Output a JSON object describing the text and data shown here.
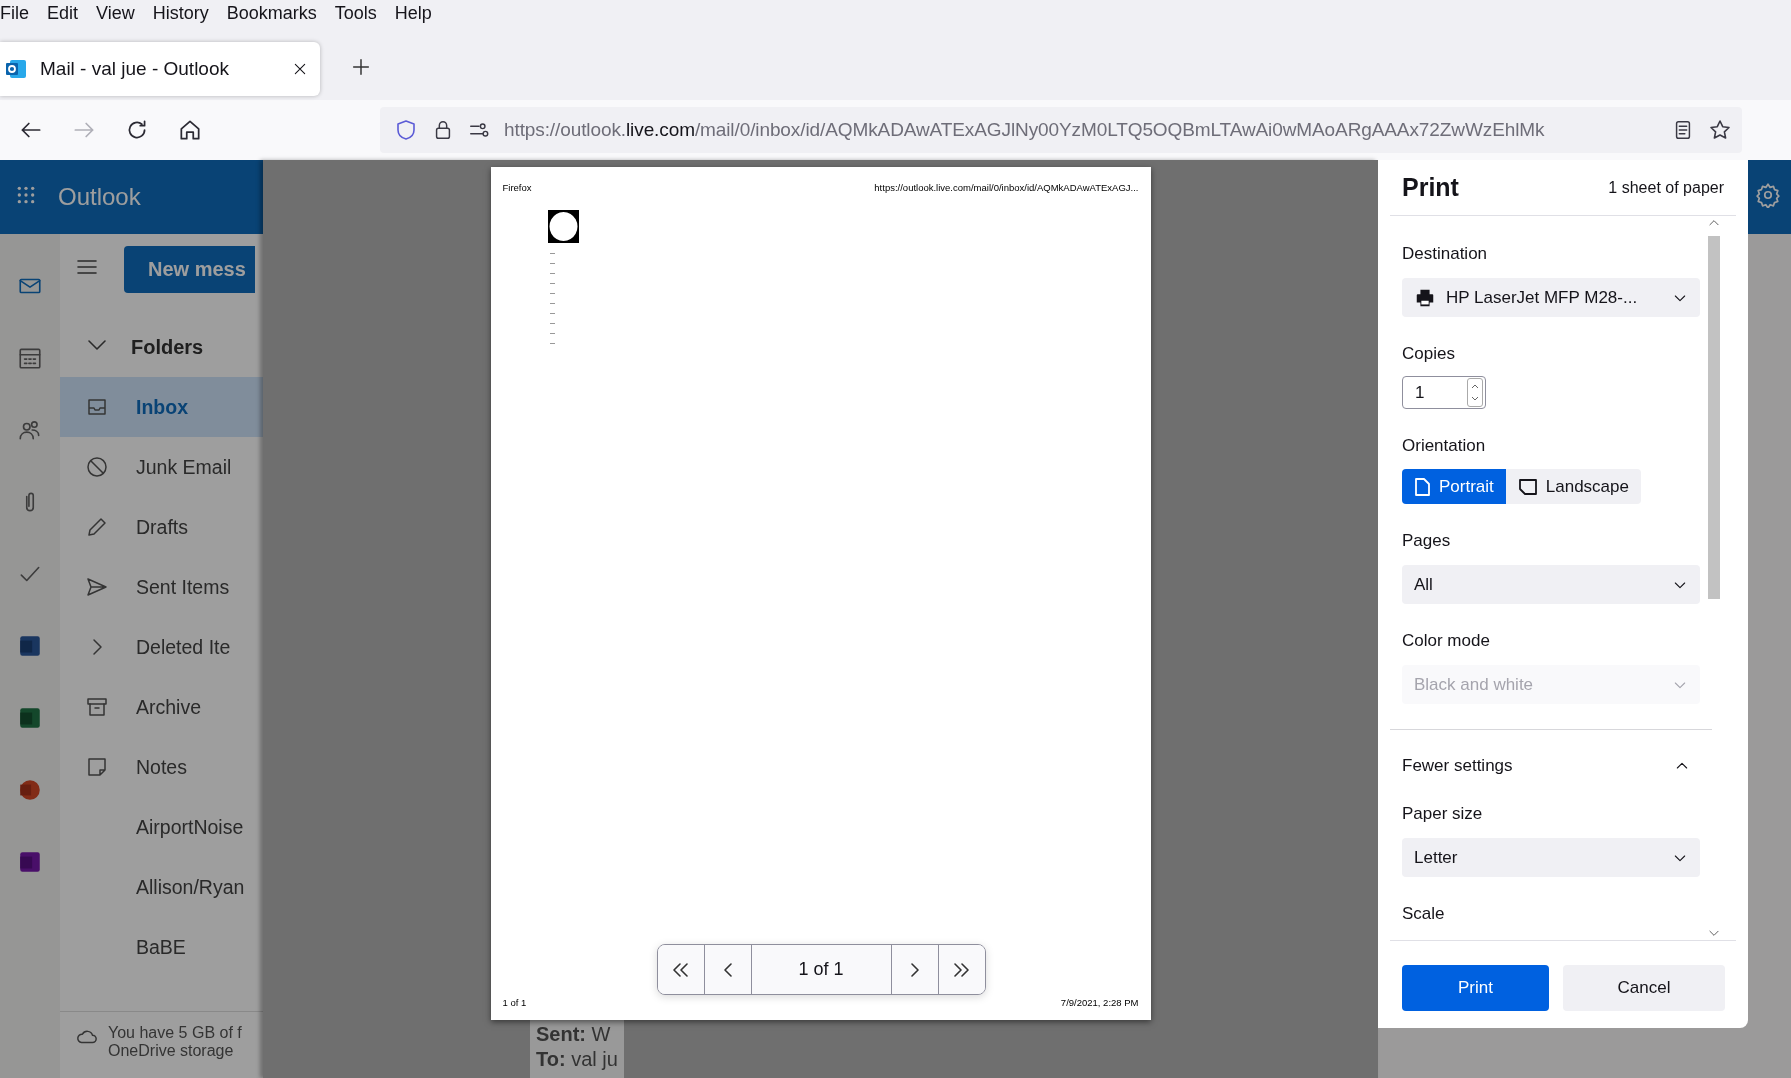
{
  "menu_bar": [
    {
      "label": "File"
    },
    {
      "label": "Edit"
    },
    {
      "label": "View"
    },
    {
      "label": "History"
    },
    {
      "label": "Bookmarks"
    },
    {
      "label": "Tools"
    },
    {
      "label": "Help"
    }
  ],
  "tab": {
    "title": "Mail - val jue - Outlook",
    "selected": true
  },
  "nav_buttons": [
    {
      "kind": "back",
      "disabled": false
    },
    {
      "kind": "forward",
      "disabled": true
    },
    {
      "kind": "reload",
      "disabled": false
    },
    {
      "kind": "home",
      "disabled": false
    }
  ],
  "address_bar": {
    "url_start": "https://outlook.",
    "url_host": "live.com",
    "url_rest": "/mail/0/inbox/id/AQMkADAwATExAGJlNy00YzM0LTQ5OQBmLTAwAi0wMAoARgAAAx72ZwWzEhlMk"
  },
  "outlook": {
    "app_name": "Outlook",
    "rail": [
      {
        "kind": "mail",
        "selected": true
      },
      {
        "kind": "calendar",
        "selected": false
      },
      {
        "kind": "people",
        "selected": false
      },
      {
        "kind": "attach",
        "selected": false
      },
      {
        "kind": "todo",
        "selected": false
      }
    ],
    "apps": [
      {
        "kind": "word"
      },
      {
        "kind": "excel"
      },
      {
        "kind": "powerpoint"
      },
      {
        "kind": "onenote"
      }
    ],
    "new_message": "New mess",
    "folders_heading": "Folders",
    "folders": [
      {
        "label": "Inbox",
        "kind": "inbox",
        "selected": true
      },
      {
        "label": "Junk Email",
        "kind": "junk",
        "selected": false
      },
      {
        "label": "Drafts",
        "kind": "drafts",
        "selected": false
      },
      {
        "label": "Sent Items",
        "kind": "sent",
        "selected": false
      },
      {
        "label": "Deleted Ite",
        "kind": "collapsed",
        "selected": false
      },
      {
        "label": "Archive",
        "kind": "archive",
        "selected": false
      },
      {
        "label": "Notes",
        "kind": "notes",
        "selected": false
      },
      {
        "label": "AirportNoise",
        "kind": "custom",
        "selected": false
      },
      {
        "label": "Allison/Ryan",
        "kind": "custom",
        "selected": false
      },
      {
        "label": "BaBE",
        "kind": "custom",
        "selected": false
      }
    ],
    "storage_note": [
      "You have 5 GB of f",
      "OneDrive storage"
    ],
    "reading_peek": [
      "**Sent:** W",
      "**To:** val ju"
    ]
  },
  "preview": {
    "header_left": "Firefox",
    "header_right": "https://outlook.live.com/mail/0/inbox/id/AQMkADAwATExAGJ...",
    "footer_left": "1 of 1",
    "footer_right": "7/9/2021, 2:28 PM",
    "pager": "1 of 1"
  },
  "print": {
    "title": "Print",
    "sheets": "1 sheet of paper",
    "destination": {
      "label": "Destination",
      "value": "HP LaserJet MFP M28-..."
    },
    "copies": {
      "label": "Copies",
      "value": "1"
    },
    "orientation": {
      "label": "Orientation",
      "options": [
        {
          "label": "Portrait",
          "kind": "portrait",
          "selected": true
        },
        {
          "label": "Landscape",
          "kind": "landscape",
          "selected": false
        }
      ]
    },
    "pages": {
      "label": "Pages",
      "value": "All"
    },
    "color_mode": {
      "label": "Color mode",
      "value": "Black and white",
      "disabled": true
    },
    "more_settings": {
      "label": "Fewer settings",
      "expanded": true
    },
    "paper_size": {
      "label": "Paper size",
      "value": "Letter"
    },
    "scale": {
      "label": "Scale"
    },
    "buttons": [
      {
        "label": "Print",
        "kind": "primary"
      },
      {
        "label": "Cancel",
        "kind": "secondary"
      }
    ]
  }
}
